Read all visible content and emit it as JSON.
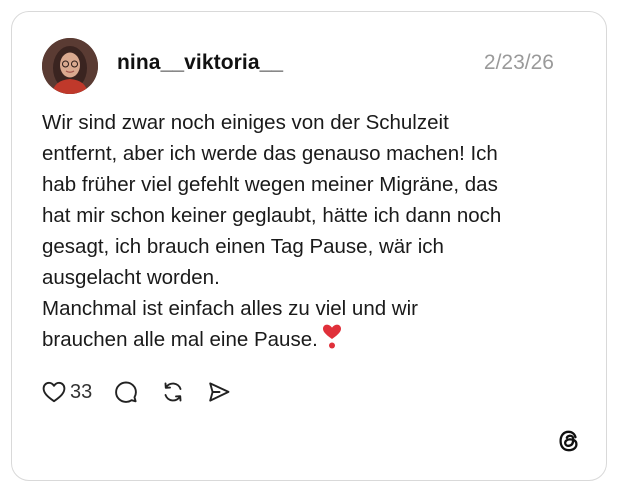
{
  "post": {
    "username": "nina__viktoria__",
    "timestamp": "2/23/26",
    "text_lines": [
      "Wir sind zwar noch einiges von der Schulzeit",
      "entfernt, aber ich werde das genauso machen! Ich",
      "hab früher viel gefehlt wegen meiner Migräne, das",
      "hat mir schon keiner geglaubt, hätte ich dann noch",
      "gesagt, ich brauch einen Tag Pause, wär ich",
      "ausgelacht worden.",
      "Manchmal ist einfach alles zu viel und wir",
      "brauchen alle mal eine Pause."
    ],
    "emoji": "heart-exclamation-emoji",
    "like_count": "33"
  },
  "icons": {
    "like": "heart-icon",
    "reply": "comment-icon",
    "repost": "repost-icon",
    "share": "send-icon",
    "brand": "threads-logo-icon"
  },
  "colors": {
    "border": "#d9d9d9",
    "text": "#1a1a1a",
    "muted": "#9a9a9a",
    "emoji_red": "#e0303a"
  }
}
